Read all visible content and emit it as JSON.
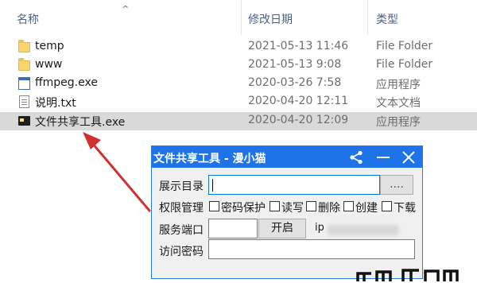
{
  "explorer": {
    "columns": {
      "name": "名称",
      "date": "修改日期",
      "type": "类型"
    },
    "sort_indicator": "^",
    "files": [
      {
        "name": "temp",
        "date": "2021-05-13 11:46",
        "type": "File Folder",
        "icon": "folder-icon"
      },
      {
        "name": "www",
        "date": "2021-05-13 9:08",
        "type": "File Folder",
        "icon": "folder-icon"
      },
      {
        "name": "ffmpeg.exe",
        "date": "2020-03-26 7:58",
        "type": "应用程序",
        "icon": "exe-icon"
      },
      {
        "name": "说明.txt",
        "date": "2020-04-20 12:11",
        "type": "文本文档",
        "icon": "text-file-icon"
      },
      {
        "name": "文件共享工具.exe",
        "date": "2020-04-20 12:09",
        "type": "应用程序",
        "icon": "app-exe-icon",
        "selected": true
      }
    ]
  },
  "app": {
    "title": "文件共享工具 - 漫小猫",
    "labels": {
      "dir": "展示目录",
      "perm": "权限管理",
      "port": "服务端口",
      "password": "访问密码"
    },
    "browse_button": "....",
    "start_button": "开启",
    "ip_prefix": "ip",
    "permissions": [
      "密码保护",
      "读写",
      "删除",
      "创建",
      "下载"
    ]
  },
  "colors": {
    "titlebar": "#1e73e8",
    "selection": "#d9d9d9",
    "arrow": "#d03030"
  }
}
